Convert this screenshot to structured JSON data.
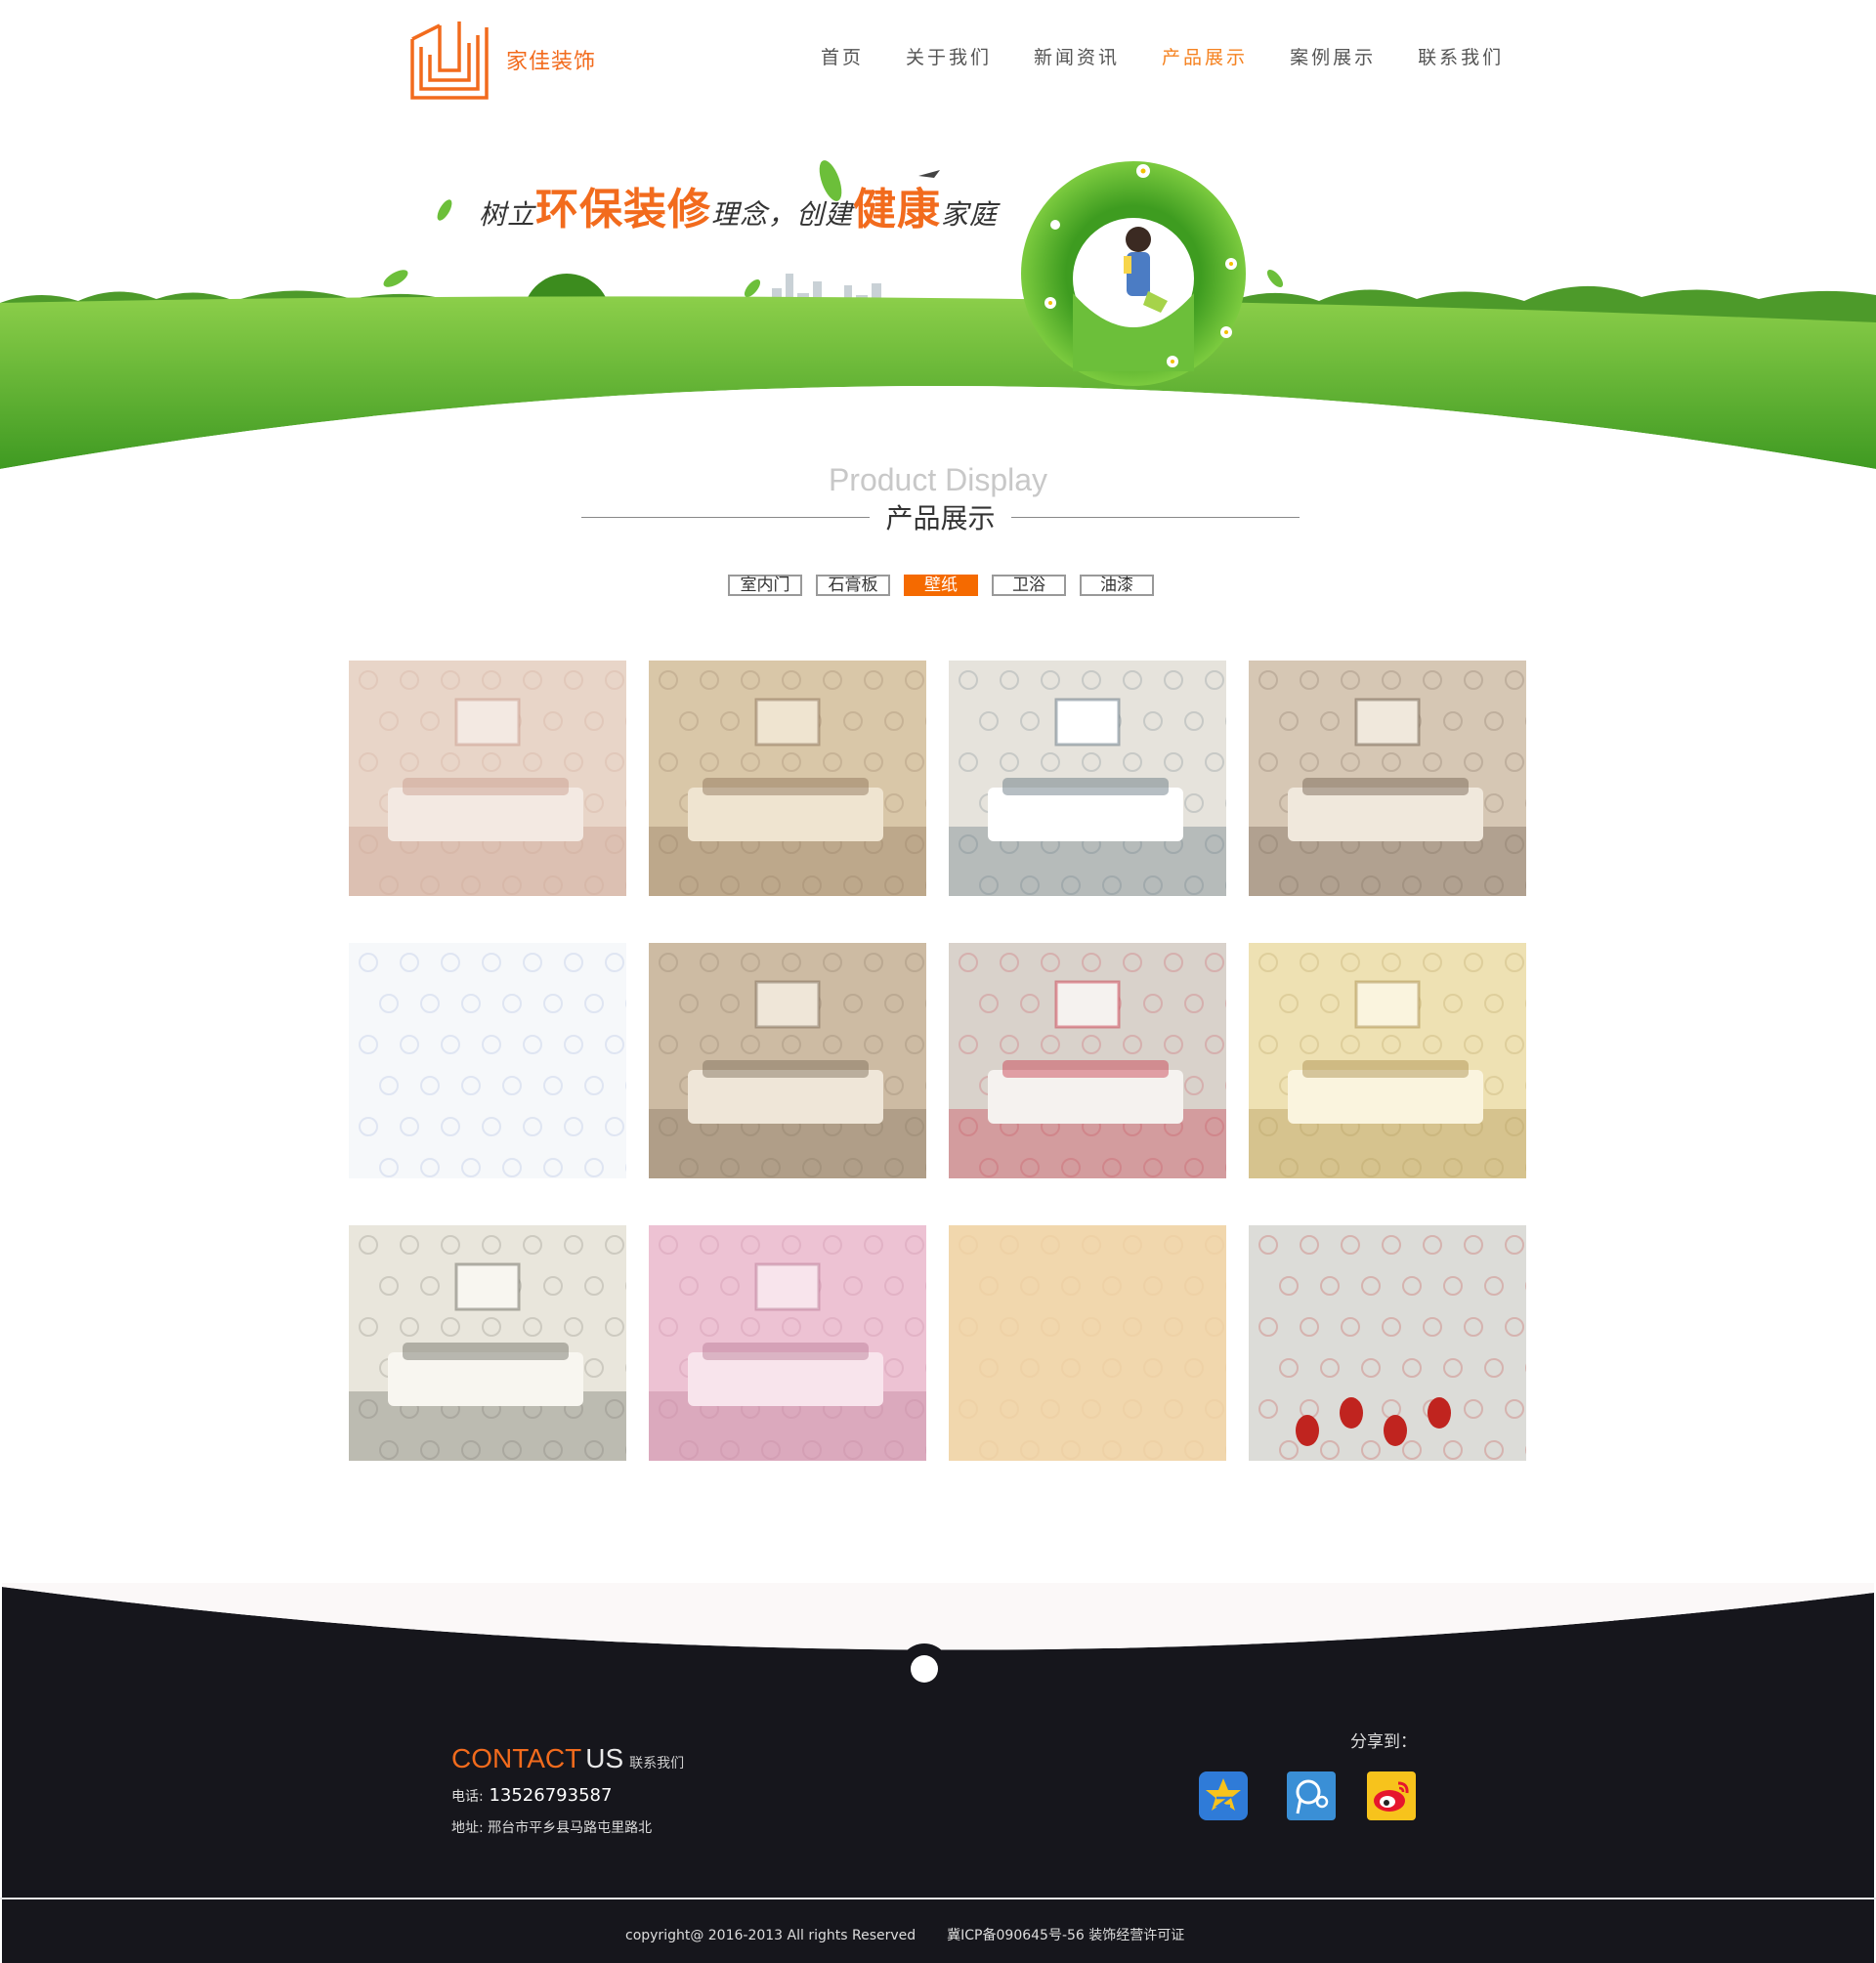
{
  "header": {
    "brand": "家佳装饰",
    "nav": [
      {
        "label": "首页"
      },
      {
        "label": "关于我们"
      },
      {
        "label": "新闻资讯"
      },
      {
        "label": "产品展示",
        "active": true
      },
      {
        "label": "案例展示"
      },
      {
        "label": "联系我们"
      }
    ]
  },
  "banner": {
    "slogan_1": "树立",
    "slogan_2": "环保装修",
    "slogan_3": "理念，",
    "slogan_4": "创建",
    "slogan_5": "健康",
    "slogan_6": "家庭"
  },
  "section": {
    "title_en": "Product Display",
    "title_zh": "产品展示"
  },
  "tabs": [
    {
      "label": "室内门"
    },
    {
      "label": "石膏板"
    },
    {
      "label": "壁纸",
      "active": true
    },
    {
      "label": "卫浴"
    },
    {
      "label": "油漆"
    }
  ],
  "products": [
    {
      "name": "bedroom-floral-wallpaper",
      "colors": [
        "#e8d5c8",
        "#f3e9e2",
        "#c79a8a"
      ]
    },
    {
      "name": "dining-damask-wallpaper",
      "colors": [
        "#d9c7a8",
        "#efe4d0",
        "#8a6f55"
      ]
    },
    {
      "name": "circle-pattern-bedroom",
      "colors": [
        "#e6e3dc",
        "#ffffff",
        "#5d6f7b"
      ]
    },
    {
      "name": "living-room-beige",
      "colors": [
        "#d6c7b4",
        "#f0e8dc",
        "#6e5d4c"
      ]
    },
    {
      "name": "blue-floral-swatch",
      "colors": [
        "#f6f8fa",
        "#ffffff",
        "#8fa5d8"
      ]
    },
    {
      "name": "living-room-chandelier",
      "colors": [
        "#cdbba3",
        "#efe6d8",
        "#7b6a57"
      ]
    },
    {
      "name": "bedroom-red-floral-bed",
      "colors": [
        "#d9d2cb",
        "#f5f2ef",
        "#c8384a"
      ]
    },
    {
      "name": "yellow-vine-living-room",
      "colors": [
        "#eee1b3",
        "#faf4de",
        "#a88b4a"
      ]
    },
    {
      "name": "white-tv-wall",
      "colors": [
        "#e9e6dc",
        "#f8f6f0",
        "#6b6a60"
      ]
    },
    {
      "name": "pink-butterfly-room",
      "colors": [
        "#edc2d3",
        "#f8e4ec",
        "#b97a95"
      ]
    },
    {
      "name": "peach-scroll-swatch",
      "colors": [
        "#f1d7ad",
        "#f7e6c8",
        "#e3bf8b"
      ]
    },
    {
      "name": "grey-damask-tulips",
      "colors": [
        "#dcdcd8",
        "#eeeeea",
        "#c0241f"
      ]
    }
  ],
  "footer": {
    "contact_en_1": "CONTACT",
    "contact_en_2": "US",
    "contact_zh": "联系我们",
    "phone_label": "电话:",
    "phone": "13526793587",
    "address": "地址: 邢台市平乡县马路屯里路北",
    "share_label": "分享到：",
    "share_icons": [
      "qzone-icon",
      "tencent-weibo-icon",
      "sina-weibo-icon"
    ],
    "copyright": "copyright@ 2016-2013   All rights Reserved",
    "icp": "冀ICP备090645号-56 装饰经营许可证"
  },
  "colors": {
    "accent": "#f26b1d",
    "nav_active": "#f58220",
    "tab_active": "#f56a00",
    "footer_bg": "#16161c",
    "grass": "#5fb832"
  }
}
